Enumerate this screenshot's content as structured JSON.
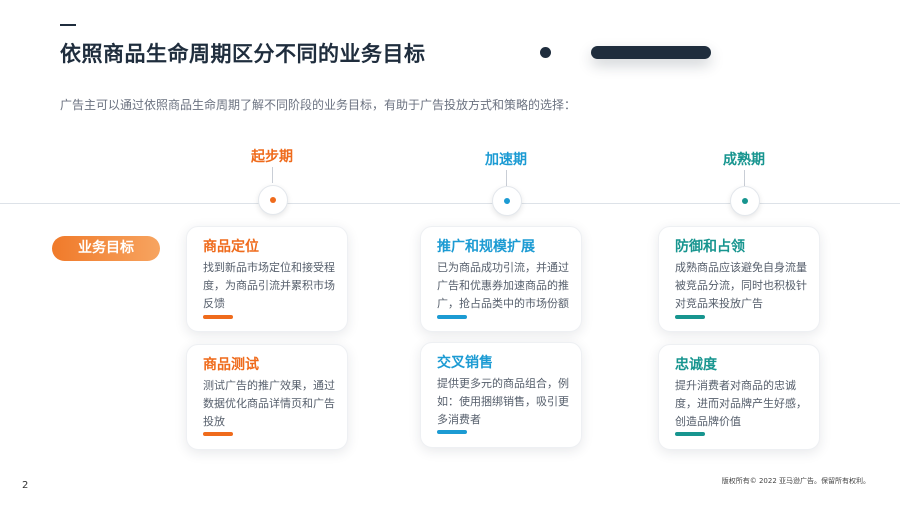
{
  "header": {
    "title": "依照商品生命周期区分不同的业务目标",
    "subtitle": "广告主可以通过依照商品生命周期了解不同阶段的业务目标，有助于广告投放方式和策略的选择："
  },
  "label": {
    "business_goal": "业务目标"
  },
  "stages": [
    {
      "name": "起步期",
      "color": "#ef6b1c"
    },
    {
      "name": "加速期",
      "color": "#1c9bd3"
    },
    {
      "name": "成熟期",
      "color": "#17958f"
    }
  ],
  "cards": {
    "c11": {
      "title": "商品定位",
      "body": "找到新品市场定位和接受程度，为商品引流并累积市场反馈"
    },
    "c12": {
      "title": "商品测试",
      "body": "测试广告的推广效果，通过数据优化商品详情页和广告投放"
    },
    "c21": {
      "title": "推广和规模扩展",
      "body": "已为商品成功引流，并通过广告和优惠券加速商品的推广，抢占品类中的市场份额"
    },
    "c22": {
      "title": "交叉销售",
      "body": "提供更多元的商品组合，例如：使用捆绑销售，吸引更多消费者"
    },
    "c31": {
      "title": "防御和占领",
      "body": "成熟商品应该避免自身流量被竞品分流，同时也积极针对竞品来投放广告"
    },
    "c32": {
      "title": "忠诚度",
      "body": "提升消费者对商品的忠诚度，进而对品牌产生好感，创造品牌价值"
    }
  },
  "footer": {
    "page_number": "2",
    "copyright": "版权所有© 2022 亚马逊广告。保留所有权利。"
  }
}
